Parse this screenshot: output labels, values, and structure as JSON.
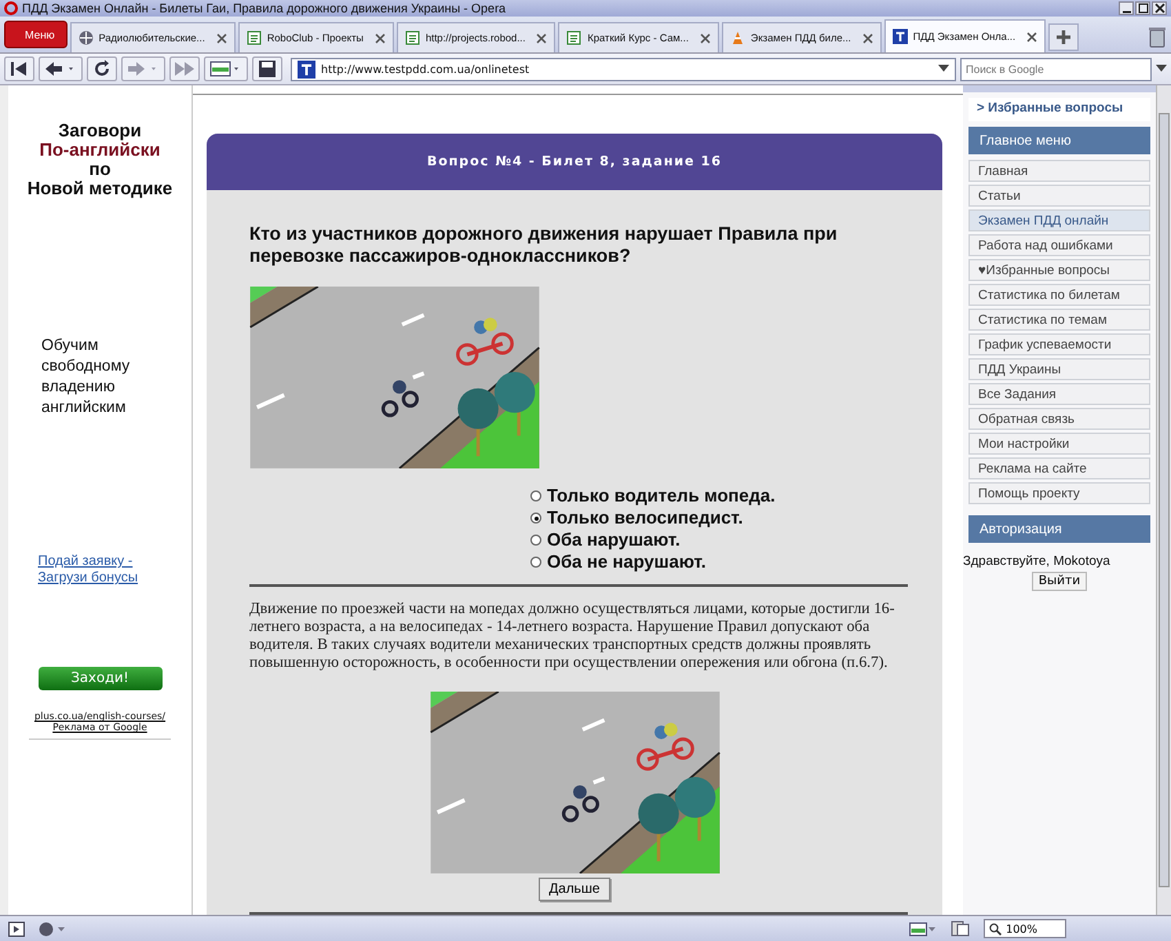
{
  "window": {
    "title": "ПДД Экзамен Онлайн - Билеты Гаи, Правила дорожного движения Украины - Opera"
  },
  "browser": {
    "menu_button": "Меню",
    "address": "http://www.testpdd.com.ua/onlinetest",
    "search_placeholder": "Поиск в Google",
    "zoom": "100%"
  },
  "tabs": [
    {
      "label": "Радиолюбительские...",
      "selected": false,
      "kind": "globe"
    },
    {
      "label": "RoboClub - Проекты",
      "selected": false,
      "kind": "page"
    },
    {
      "label": "http://projects.robod...",
      "selected": false,
      "kind": "page"
    },
    {
      "label": "Краткий Курс - Сам...",
      "selected": false,
      "kind": "page"
    },
    {
      "label": "Экзамен ПДД биле...",
      "selected": false,
      "kind": "cone"
    },
    {
      "label": "ПДД Экзамен Онла...",
      "selected": true,
      "kind": "site"
    }
  ],
  "left_ad": {
    "headline": [
      {
        "text": "Заговори",
        "accent": false
      },
      {
        "text": "По-английски",
        "accent": true
      },
      {
        "text": "по",
        "accent": false
      },
      {
        "text": "Новой методике",
        "accent": false
      }
    ],
    "tagline": "Обучим свободному владению английским",
    "link": "Подай заявку - Загрузи бонусы",
    "button": "Заходи!",
    "source_url": "plus.co.ua/english-courses/",
    "source_label": "Реклама от Google"
  },
  "question": {
    "header": "Вопрос №4 - Билет 8, задание 16",
    "text": "Кто из участников дорожного движения нарушает Правила при перевозке пассажиров-одноклассников?",
    "options": [
      {
        "label": "Только водитель мопеда.",
        "selected": false
      },
      {
        "label": "Только велосипедист.",
        "selected": true
      },
      {
        "label": "Оба нарушают.",
        "selected": false
      },
      {
        "label": "Оба не нарушают.",
        "selected": false
      }
    ],
    "explanation": "Движение по проезжей части на мопедах должно осуществляться лицами, которые достигли 16-летнего возраста, а на велосипедах - 14-летнего возраста. Нарушение Правил допускают оба водителя. В таких случаях водители механических транспортных средств должны проявлять повышенную осторожность, в особенности при осуществлении опережения или обгона (п.6.7).",
    "next_button": "Дальше"
  },
  "sidebar": {
    "favorites_link": "> Избранные вопросы",
    "menu_title": "Главное меню",
    "items": [
      {
        "label": "Главная",
        "selected": false
      },
      {
        "label": "Статьи",
        "selected": false
      },
      {
        "label": "Экзамен ПДД онлайн",
        "selected": true
      },
      {
        "label": "Работа над ошибками",
        "selected": false
      },
      {
        "label": "♥Избранные вопросы",
        "selected": false
      },
      {
        "label": "Статистика по билетам",
        "selected": false
      },
      {
        "label": "Статистика по темам",
        "selected": false
      },
      {
        "label": "График успеваемости",
        "selected": false
      },
      {
        "label": "ПДД Украины",
        "selected": false
      },
      {
        "label": "Все Задания",
        "selected": false
      },
      {
        "label": "Обратная связь",
        "selected": false
      },
      {
        "label": "Мои настройки",
        "selected": false
      },
      {
        "label": "Реклама на сайте",
        "selected": false
      },
      {
        "label": "Помощь проекту",
        "selected": false
      }
    ],
    "auth_title": "Авторизация",
    "greeting": "Здравствуйте, Mokotoya",
    "logout_button": "Выйти"
  }
}
